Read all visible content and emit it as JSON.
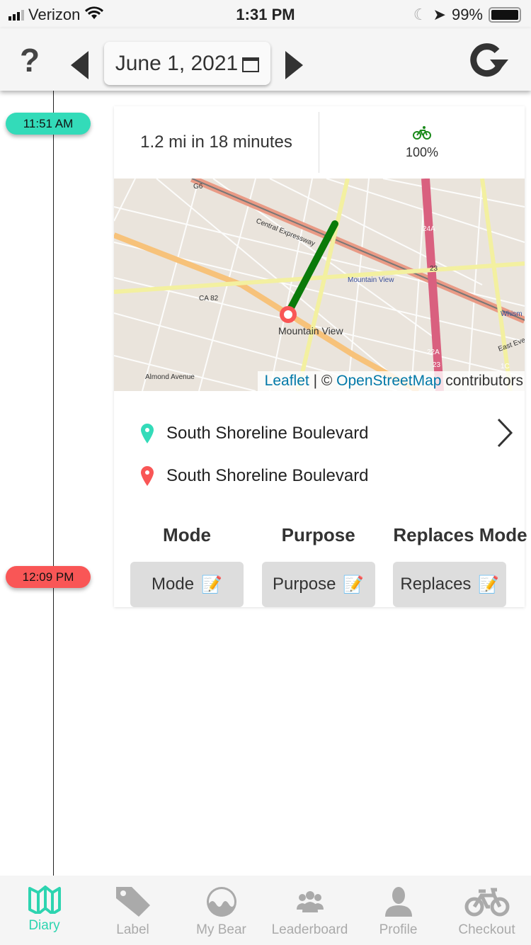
{
  "status_bar": {
    "carrier": "Verizon",
    "time": "1:31 PM",
    "battery": "99%"
  },
  "header": {
    "help": "?",
    "date": "June 1, 2021"
  },
  "timeline": {
    "start_time": "11:51 AM",
    "end_time": "12:09 PM",
    "start_color": "#33dbb9",
    "end_color": "#f95656"
  },
  "trip": {
    "distance_duration": "1.2 mi in 18 minutes",
    "mode_icon": "bicycle-icon",
    "mode_percent": "100%",
    "route_color": "#0a7a0a"
  },
  "map": {
    "labels": [
      "G6",
      "Central Expressway",
      "CA 82",
      "Mountain View",
      "Mountain View",
      "Almond Avenue",
      "24A",
      "23",
      "22A",
      "23",
      "Whism",
      "East Eve",
      "1C"
    ],
    "attribution": {
      "leaflet": "Leaflet",
      "sep": " | © ",
      "osm": "OpenStreetMap",
      "suffix": " contributors"
    }
  },
  "places": {
    "start": "South Shoreline Boulevard",
    "end": "South Shoreline Boulevard"
  },
  "labels": {
    "mode_header": "Mode",
    "purpose_header": "Purpose",
    "replaces_header": "Replaces Mode",
    "mode_btn": "Mode",
    "purpose_btn": "Purpose",
    "replaces_btn": "Replaces"
  },
  "tabs": [
    {
      "label": "Diary",
      "icon": "map-icon",
      "active": true
    },
    {
      "label": "Label",
      "icon": "tag-icon"
    },
    {
      "label": "My Bear",
      "icon": "bear-icon"
    },
    {
      "label": "Leaderboard",
      "icon": "group-icon"
    },
    {
      "label": "Profile",
      "icon": "person-icon"
    },
    {
      "label": "Checkout",
      "icon": "bicycle-icon"
    }
  ]
}
